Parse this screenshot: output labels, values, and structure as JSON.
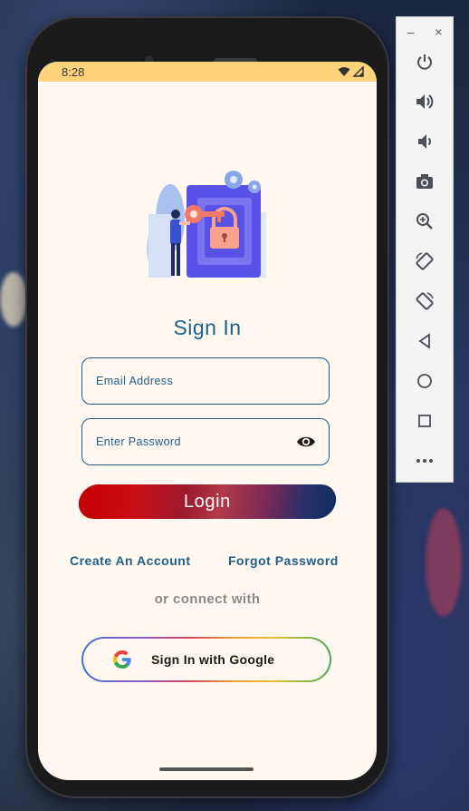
{
  "status_bar": {
    "time": "8:28"
  },
  "screen": {
    "title": "Sign In",
    "email_field": {
      "placeholder": "Email Address"
    },
    "password_field": {
      "placeholder": "Enter Password"
    },
    "login_label": "Login",
    "create_account": "Create An Account",
    "forgot_password": "Forgot Password",
    "connect_text": "or connect with",
    "google_button": "Sign In with Google"
  },
  "emulator_toolbar": {
    "minimize": "–",
    "close": "×",
    "items": [
      "power-icon",
      "volume-up-icon",
      "volume-down-icon",
      "camera-icon",
      "zoom-icon",
      "rotate-left-icon",
      "rotate-right-icon",
      "back-icon",
      "home-icon",
      "overview-icon",
      "more-icon"
    ]
  },
  "colors": {
    "accent_blue": "#1f5f8a",
    "status_bar": "#ffd27c",
    "screen_bg": "#fef8f1"
  }
}
